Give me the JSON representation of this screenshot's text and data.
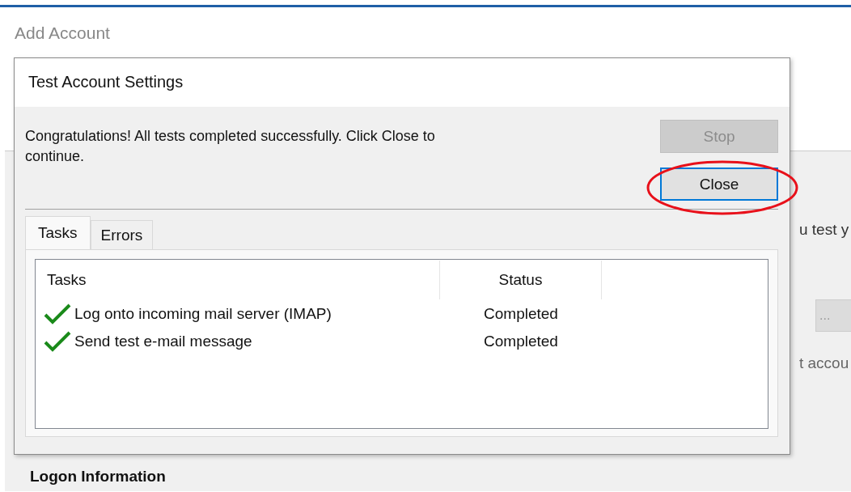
{
  "background": {
    "title": "Add Account",
    "fragment_top": "u test y",
    "button": "...",
    "fragment_bottom": "t accou",
    "section": "Logon Information"
  },
  "dialog": {
    "title": "Test Account Settings",
    "message": "Congratulations! All tests completed successfully. Click Close to continue.",
    "buttons": [
      {
        "label": "Stop",
        "disabled": true,
        "focused": false
      },
      {
        "label": "Close",
        "disabled": false,
        "focused": true
      }
    ],
    "tabs": [
      {
        "label": "Tasks",
        "selected": true
      },
      {
        "label": "Errors",
        "selected": false
      }
    ],
    "table": {
      "columns": [
        "Tasks",
        "Status"
      ],
      "rows": [
        {
          "task": "Log onto incoming mail server (IMAP)",
          "status": "Completed",
          "done": true
        },
        {
          "task": "Send test e-mail message",
          "status": "Completed",
          "done": true
        }
      ]
    }
  },
  "annotation": {
    "kind": "ellipse"
  }
}
